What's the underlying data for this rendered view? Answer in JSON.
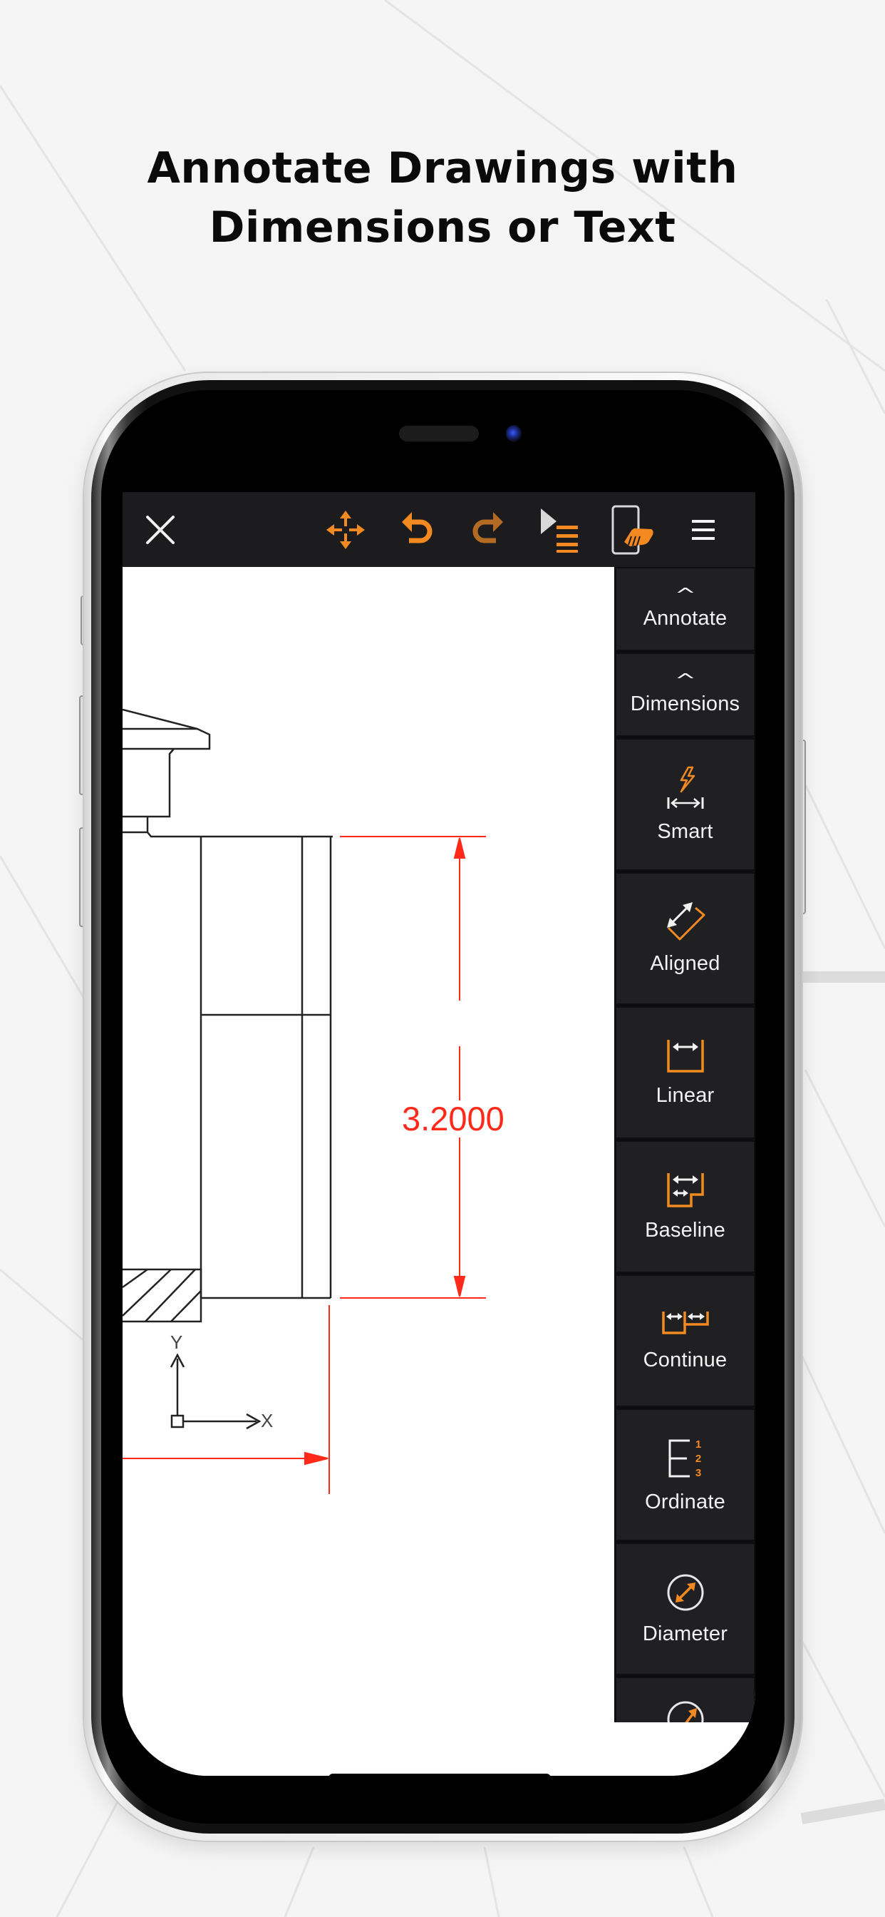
{
  "headline": {
    "line1": "Annotate Drawings with",
    "line2": "Dimensions or Text"
  },
  "toolbar": {
    "close_icon": "close-icon",
    "items": [
      {
        "name": "move-tool",
        "icon": "move-arrows-icon"
      },
      {
        "name": "undo",
        "icon": "undo-icon"
      },
      {
        "name": "redo",
        "icon": "redo-icon"
      },
      {
        "name": "layout-list",
        "icon": "play-list-icon"
      },
      {
        "name": "touch-mode",
        "icon": "hand-tap-icon"
      },
      {
        "name": "menu",
        "icon": "hamburger-menu-icon"
      }
    ]
  },
  "panel": {
    "sections": [
      {
        "label": "Annotate",
        "icon": "chevron-up-icon"
      },
      {
        "label": "Dimensions",
        "icon": "chevron-up-icon"
      }
    ],
    "tools": [
      {
        "label": "Smart",
        "icon": "smart-dimension-icon"
      },
      {
        "label": "Aligned",
        "icon": "aligned-dimension-icon"
      },
      {
        "label": "Linear",
        "icon": "linear-dimension-icon"
      },
      {
        "label": "Baseline",
        "icon": "baseline-dimension-icon"
      },
      {
        "label": "Continue",
        "icon": "continue-dimension-icon"
      },
      {
        "label": "Ordinate",
        "icon": "ordinate-dimension-icon"
      },
      {
        "label": "Diameter",
        "icon": "diameter-dimension-icon"
      },
      {
        "label": "",
        "icon": "radius-dimension-icon"
      }
    ]
  },
  "drawing": {
    "dimension_value": "3.2000",
    "ucs_x_label": "X",
    "ucs_y_label": "Y"
  },
  "colors": {
    "accent": "#f28a21",
    "toolbar_bg": "#1c1c1e",
    "panel_item_bg": "#202023",
    "dimension": "#ff2a1a",
    "icon_white": "#f2f2f2"
  }
}
